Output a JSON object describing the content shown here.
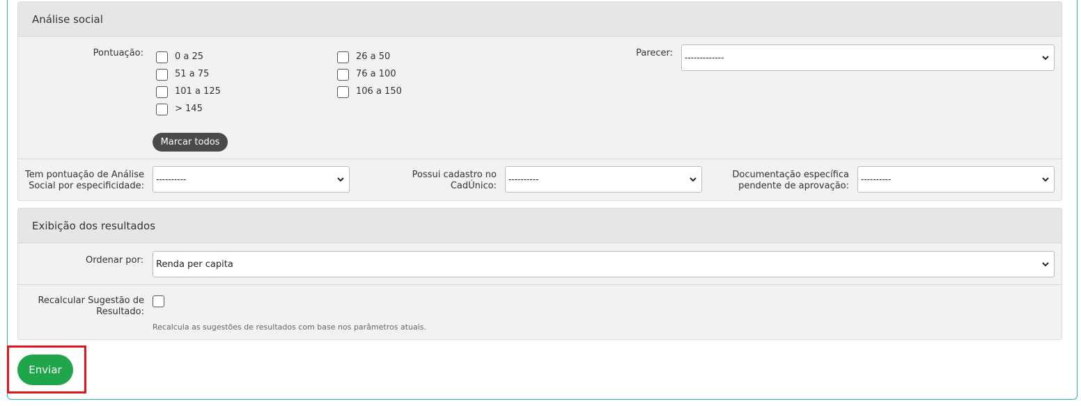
{
  "social": {
    "title": "Análise social",
    "pontuacao_label": "Pontuação:",
    "options": [
      "0 a 25",
      "26 a 50",
      "51 a 75",
      "76 a 100",
      "101 a 125",
      "106 a 150",
      "> 145"
    ],
    "mark_all": "Marcar todos",
    "parecer_label": "Parecer:",
    "parecer_value": "-------------",
    "specificity_label_1": "Tem pontuação de Análise",
    "specificity_label_2": "Social por especificidade:",
    "specificity_value": "----------",
    "cadunico_label_1": "Possui cadastro no",
    "cadunico_label_2": "CadÚnico:",
    "cadunico_value": "----------",
    "docs_label_1": "Documentação específica",
    "docs_label_2": "pendente de aprovação:",
    "docs_value": "----------"
  },
  "results": {
    "title": "Exibição dos resultados",
    "order_label": "Ordenar por:",
    "order_value": "Renda per capita",
    "recalc_label_1": "Recalcular Sugestão de",
    "recalc_label_2": "Resultado:",
    "recalc_help": "Recalcula as sugestões de resultados com base nos parâmetros atuais."
  },
  "submit_label": "Enviar",
  "colors": {
    "accent": "#2bb5a5",
    "submit": "#1fa64a",
    "highlight": "#e0141e"
  }
}
